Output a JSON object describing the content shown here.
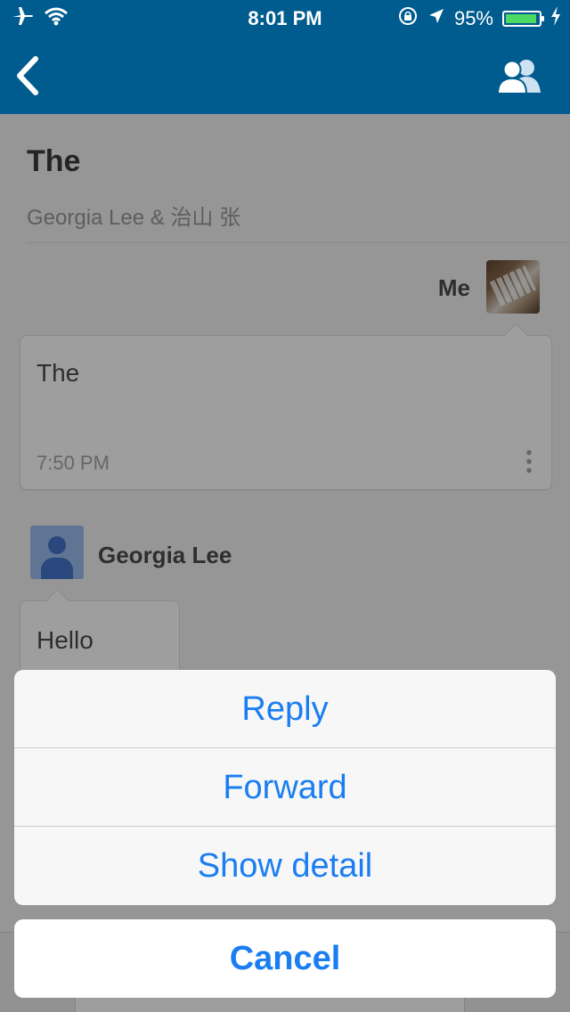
{
  "status_bar": {
    "time": "8:01 PM",
    "battery_percent": "95%",
    "battery_level": 0.95
  },
  "nav": {
    "back_icon": "chevron-left-icon",
    "participants_icon": "people-icon"
  },
  "thread": {
    "subject": "The",
    "participants": "Georgia Lee & 治山 张"
  },
  "messages": [
    {
      "sender": "Me",
      "text": "The",
      "time": "7:50 PM"
    },
    {
      "sender": "Georgia Lee",
      "text": "Hello"
    }
  ],
  "action_sheet": {
    "items": [
      "Reply",
      "Forward",
      "Show detail"
    ],
    "cancel": "Cancel"
  },
  "colors": {
    "header": "#005b8f",
    "action": "#1a7ef2"
  }
}
